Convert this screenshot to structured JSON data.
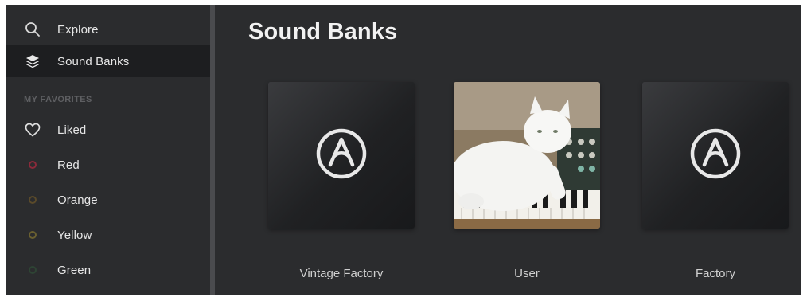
{
  "nav": {
    "explore_label": "Explore",
    "sound_banks_label": "Sound Banks"
  },
  "favorites": {
    "heading": "MY FAVORITES",
    "items": [
      {
        "label": "Liked",
        "icon": "heart-icon"
      },
      {
        "label": "Red",
        "color": "#8a2a3a"
      },
      {
        "label": "Orange",
        "color": "#5a4a2a"
      },
      {
        "label": "Yellow",
        "color": "#6a6030"
      },
      {
        "label": "Green",
        "color": "#2e4434"
      }
    ]
  },
  "main": {
    "title": "Sound Banks",
    "banks": [
      {
        "name": "Vintage Factory",
        "cover": "arturia-logo-icon"
      },
      {
        "name": "User",
        "cover": "cat-on-synth-photo"
      },
      {
        "name": "Factory",
        "cover": "arturia-logo-icon"
      }
    ]
  },
  "colors": {
    "sidebar_bg": "#2b2c2e",
    "active_bg": "#1d1e20",
    "divider": "#4a4b4e",
    "text": "#e6e6e6"
  }
}
